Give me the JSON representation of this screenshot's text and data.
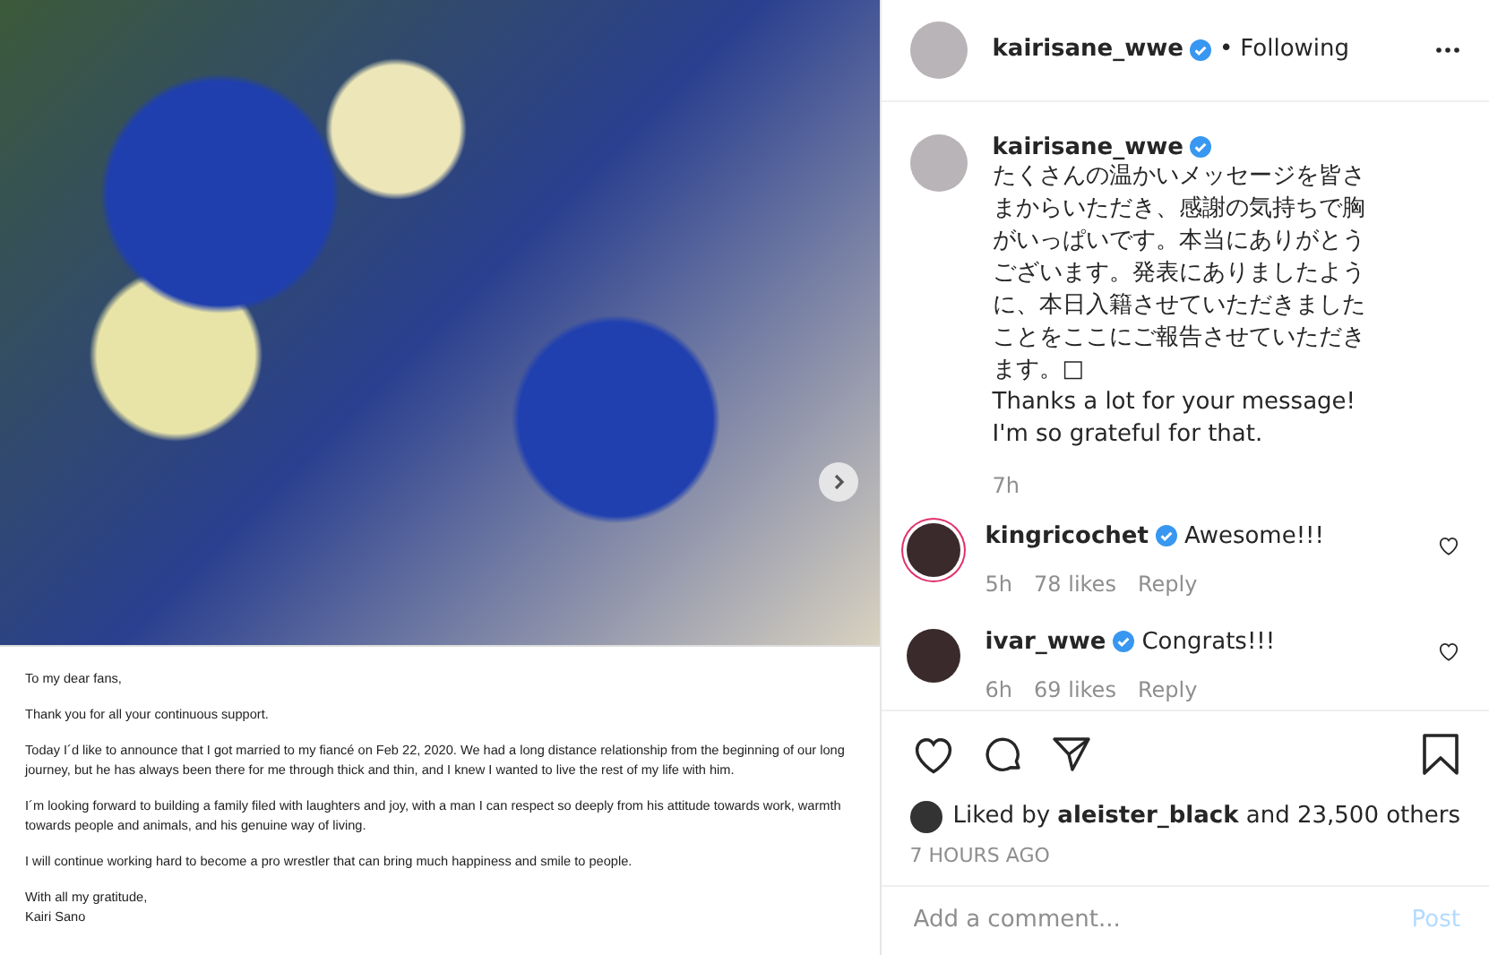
{
  "post": {
    "letter": [
      "To my dear fans,",
      "Thank you for all your continuous support.",
      "Today I´d like to announce that I got married to my fiancé on Feb 22, 2020. We had a long distance relationship from the beginning of our long journey, but he has always been there for me through thick and thin, and I knew I wanted to live the rest of my life with him.",
      "I´m looking forward to building a family filed with laughters and joy, with a man I can respect so deeply from his attitude towards work, warmth towards people and animals, and his genuine way of living.",
      "I will continue working hard to become a pro wrestler that can bring much happiness and smile to people.",
      "With all my gratitude,\nKairi Sano"
    ]
  },
  "header": {
    "username": "kairisane_wwe",
    "verified": true,
    "separator": "•",
    "follow": "Following"
  },
  "caption": {
    "username": "kairisane_wwe",
    "verified": true,
    "text": "たくさんの温かいメッセージを皆さまからいただき、感謝の気持ちで胸がいっぱいです。本当にありがとうございます。発表にありましたように、本日入籍させていただきましたことをここにご報告させていただきます。□\nThanks a lot for your message!\nI'm so grateful for that.",
    "time": "7h"
  },
  "comments": [
    {
      "username": "kingricochet",
      "verified": true,
      "story_ring": true,
      "text": "Awesome!!!",
      "time": "5h",
      "likes": "78 likes",
      "reply": "Reply",
      "liked": false
    },
    {
      "username": "ivar_wwe",
      "verified": true,
      "story_ring": false,
      "text": "Congrats!!!",
      "time": "6h",
      "likes": "69 likes",
      "reply": "Reply",
      "liked": false
    }
  ],
  "actions": {
    "liked": false,
    "saved": false
  },
  "likes": {
    "prefix": "Liked by ",
    "user": "aleister_black",
    "suffix": " and 23,500 others"
  },
  "timestamp": "7 HOURS AGO",
  "add_comment": {
    "placeholder": "Add a comment...",
    "post": "Post"
  }
}
